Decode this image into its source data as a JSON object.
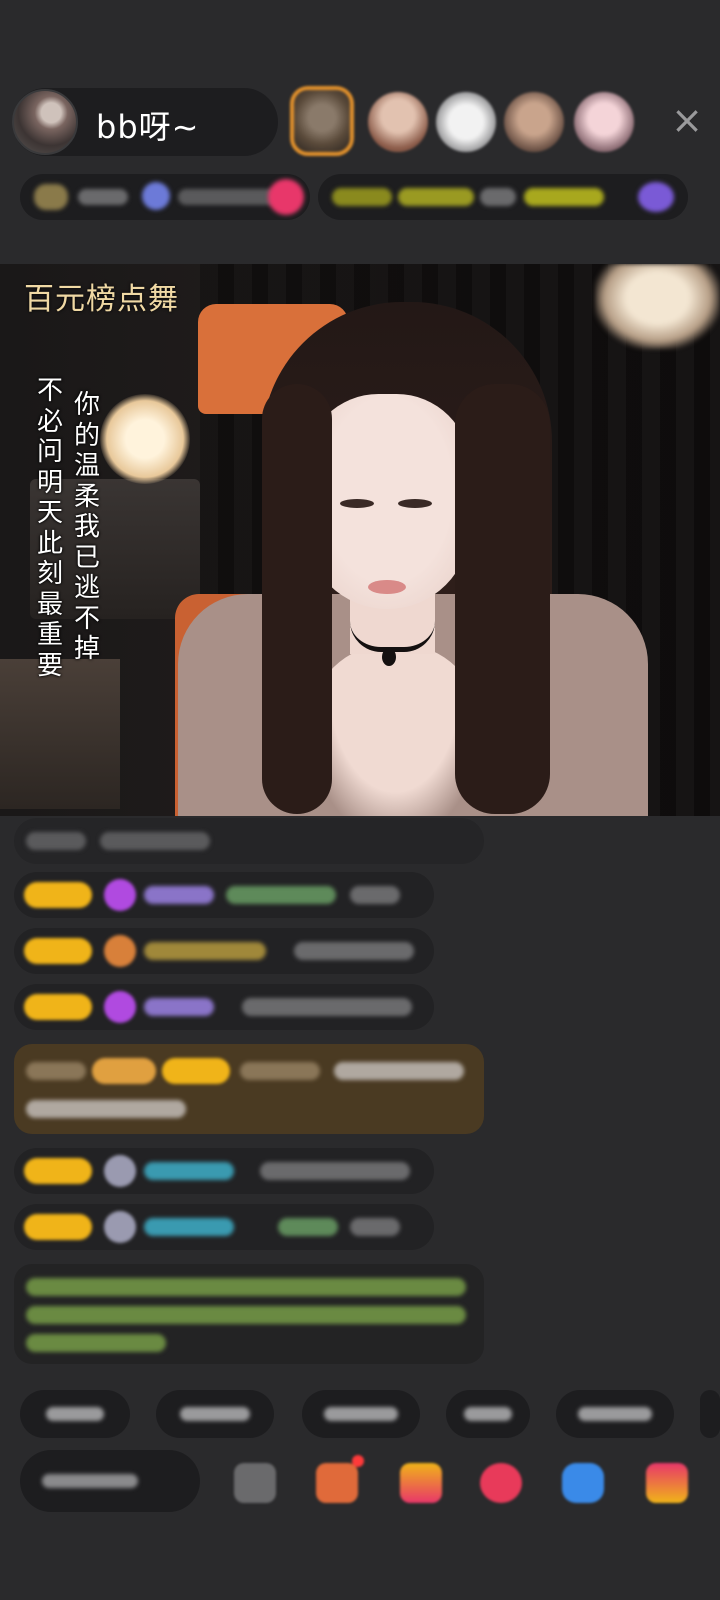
{
  "host": {
    "name": "bb呀~"
  },
  "header": {
    "close_icon": "×"
  },
  "video": {
    "title": "百元榜点舞",
    "lyric_right": "你的温柔我已逃不掉",
    "lyric_left": "不必问明天此刻最重要"
  },
  "colors": {
    "background": "#2a2a2c",
    "pill": "#1d1d1f",
    "gold_badge": "#f0b419",
    "title_gold": "#f0d9a4"
  },
  "icons": [
    "host-avatar",
    "viewer-avatar",
    "close-icon",
    "gift-icon",
    "game-icon",
    "message-icon",
    "share-icon"
  ]
}
